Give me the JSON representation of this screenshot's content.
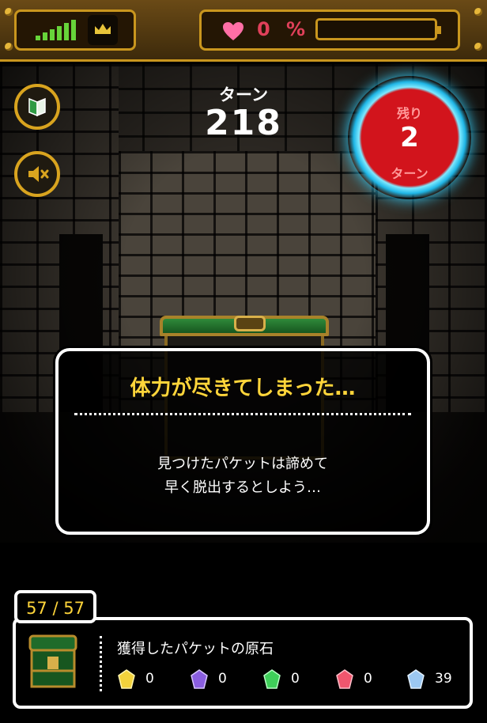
{
  "status_bar": {
    "signal_icon": "signal-bars-icon",
    "crown_icon": "crown-icon",
    "heart_icon": "heart-icon",
    "life_percent_text": "0 %",
    "life_fraction": 0
  },
  "turn": {
    "label": "ターン",
    "value": "218"
  },
  "remaining": {
    "top_label": "残り",
    "value": "2",
    "bottom_label": "ターン"
  },
  "side_buttons": {
    "beginner_icon": "beginner-leaf-icon",
    "sound_icon": "speaker-muted-icon"
  },
  "dialog": {
    "title": "体力が尽きてしまった…",
    "line1": "見つけたパケットは諦めて",
    "line2": "早く脱出するとしよう…"
  },
  "inventory": {
    "counter": "57 / 57",
    "title": "獲得したパケットの原石",
    "gems": [
      {
        "name": "yellow",
        "color": "#f2d23c",
        "count": "0"
      },
      {
        "name": "purple",
        "color": "#8a5ee0",
        "count": "0"
      },
      {
        "name": "green",
        "color": "#3fcf5a",
        "count": "0"
      },
      {
        "name": "red",
        "color": "#f0566e",
        "count": "0"
      },
      {
        "name": "blue",
        "color": "#9cc8f2",
        "count": "39"
      }
    ]
  },
  "colors": {
    "gold": "#c9961e",
    "life": "#e0405a",
    "title_yellow": "#ffd53a"
  }
}
